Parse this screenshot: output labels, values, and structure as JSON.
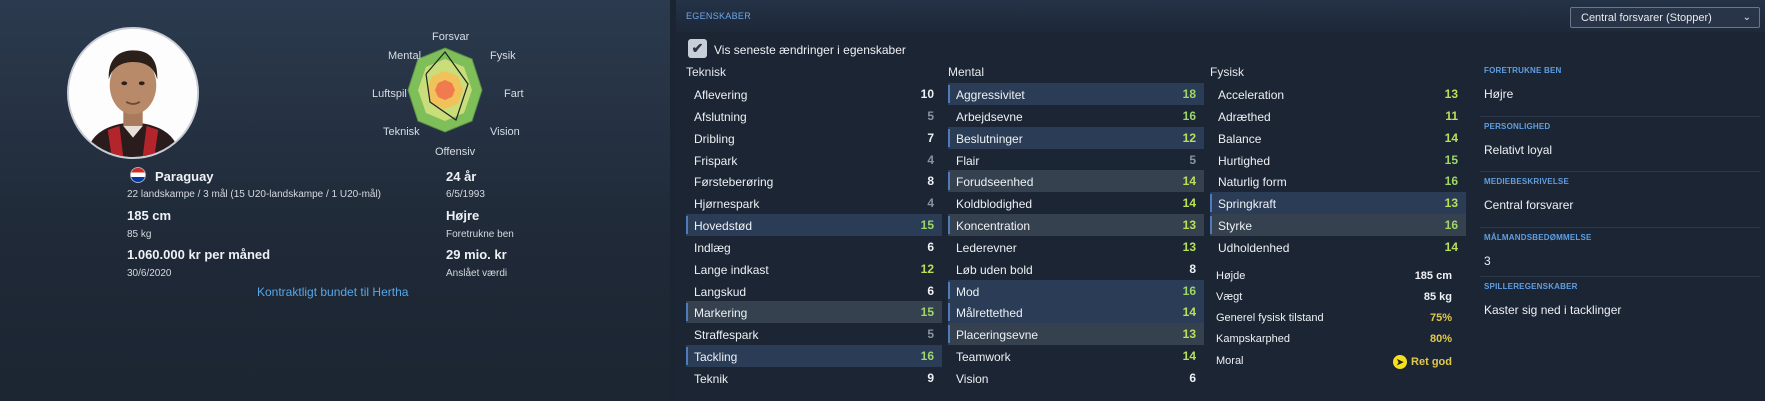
{
  "player": {
    "nation": "Paraguay",
    "caps_text": "22 landskampe / 3 mål (15 U20-landskampe / 1 U20-mål)",
    "height": "185 cm",
    "weight": "85 kg",
    "wage": "1.060.000 kr per måned",
    "contract_end": "30/6/2020",
    "age": "24 år",
    "birth_date": "6/5/1993",
    "preferred_foot": "Højre",
    "preferred_foot_label": "Foretrukne ben",
    "value": "29 mio. kr",
    "value_label": "Anslået værdi",
    "contract_link": "Kontraktligt bundet til Hertha"
  },
  "radar": {
    "labels": {
      "top": "Forsvar",
      "top_right": "Fysik",
      "right": "Fart",
      "bottom_right": "Vision",
      "bottom": "Offensiv",
      "bottom_left": "Teknisk",
      "left": "Luftspil",
      "top_left": "Mental"
    },
    "colors": {
      "outer": "#7fbf5a",
      "mid": "#c9de7a",
      "inner": "#f2c25a",
      "core": "#ef7b4e"
    }
  },
  "attributes_panel": {
    "title": "EGENSKABER",
    "role_select": "Central forsvarer (Stopper)",
    "checkbox_label": "Vis seneste ændringer i egenskaber",
    "checkbox_checked": true,
    "columns": [
      {
        "title": "Teknisk",
        "rows": [
          {
            "name": "Aflevering",
            "value": "10",
            "color": "white",
            "highlight": ""
          },
          {
            "name": "Afslutning",
            "value": "5",
            "color": "dim",
            "highlight": ""
          },
          {
            "name": "Dribling",
            "value": "7",
            "color": "white",
            "highlight": ""
          },
          {
            "name": "Frispark",
            "value": "4",
            "color": "dim",
            "highlight": ""
          },
          {
            "name": "Førsteberøring",
            "value": "8",
            "color": "white",
            "highlight": ""
          },
          {
            "name": "Hjørnespark",
            "value": "4",
            "color": "dim",
            "highlight": ""
          },
          {
            "name": "Hovedstød",
            "value": "15",
            "color": "green",
            "highlight": "hl"
          },
          {
            "name": "Indlæg",
            "value": "6",
            "color": "white",
            "highlight": ""
          },
          {
            "name": "Lange indkast",
            "value": "12",
            "color": "lime",
            "highlight": ""
          },
          {
            "name": "Langskud",
            "value": "6",
            "color": "white",
            "highlight": ""
          },
          {
            "name": "Markering",
            "value": "15",
            "color": "green",
            "highlight": "hl2"
          },
          {
            "name": "Straffespark",
            "value": "5",
            "color": "dim",
            "highlight": ""
          },
          {
            "name": "Tackling",
            "value": "16",
            "color": "green",
            "highlight": "hl"
          },
          {
            "name": "Teknik",
            "value": "9",
            "color": "white",
            "highlight": ""
          }
        ]
      },
      {
        "title": "Mental",
        "rows": [
          {
            "name": "Aggressivitet",
            "value": "18",
            "color": "green",
            "highlight": "hl"
          },
          {
            "name": "Arbejdsevne",
            "value": "16",
            "color": "green",
            "highlight": ""
          },
          {
            "name": "Beslutninger",
            "value": "12",
            "color": "lime",
            "highlight": "hl"
          },
          {
            "name": "Flair",
            "value": "5",
            "color": "dim",
            "highlight": ""
          },
          {
            "name": "Forudseenhed",
            "value": "14",
            "color": "lime",
            "highlight": "hl2"
          },
          {
            "name": "Koldblodighed",
            "value": "14",
            "color": "lime",
            "highlight": ""
          },
          {
            "name": "Koncentration",
            "value": "13",
            "color": "lime",
            "highlight": "hl2"
          },
          {
            "name": "Lederevner",
            "value": "13",
            "color": "lime",
            "highlight": ""
          },
          {
            "name": "Løb uden bold",
            "value": "8",
            "color": "white",
            "highlight": ""
          },
          {
            "name": "Mod",
            "value": "16",
            "color": "green",
            "highlight": "hl"
          },
          {
            "name": "Målrettethed",
            "value": "14",
            "color": "lime",
            "highlight": "hl"
          },
          {
            "name": "Placeringsevne",
            "value": "13",
            "color": "lime",
            "highlight": "hl2"
          },
          {
            "name": "Teamwork",
            "value": "14",
            "color": "lime",
            "highlight": ""
          },
          {
            "name": "Vision",
            "value": "6",
            "color": "white",
            "highlight": ""
          }
        ]
      },
      {
        "title": "Fysisk",
        "rows": [
          {
            "name": "Acceleration",
            "value": "13",
            "color": "lime",
            "highlight": ""
          },
          {
            "name": "Adræthed",
            "value": "11",
            "color": "lime",
            "highlight": ""
          },
          {
            "name": "Balance",
            "value": "14",
            "color": "lime",
            "highlight": ""
          },
          {
            "name": "Hurtighed",
            "value": "15",
            "color": "green",
            "highlight": ""
          },
          {
            "name": "Naturlig form",
            "value": "16",
            "color": "green",
            "highlight": ""
          },
          {
            "name": "Springkraft",
            "value": "13",
            "color": "lime",
            "highlight": "hl"
          },
          {
            "name": "Styrke",
            "value": "16",
            "color": "green",
            "highlight": "hl2"
          },
          {
            "name": "Udholdenhed",
            "value": "14",
            "color": "lime",
            "highlight": ""
          }
        ]
      }
    ],
    "physical_info": [
      {
        "label": "Højde",
        "value": "185 cm",
        "color": "white"
      },
      {
        "label": "Vægt",
        "value": "85 kg",
        "color": "white"
      },
      {
        "label": "Generel fysisk tilstand",
        "value": "75%",
        "color": "yellow"
      },
      {
        "label": "Kampskarphed",
        "value": "80%",
        "color": "yellow"
      },
      {
        "label": "Moral",
        "value": "Ret god",
        "color": "yellow",
        "icon": "moral-arrow-icon"
      }
    ],
    "side": [
      {
        "heading": "FORETRUKNE BEN",
        "value": "Højre"
      },
      {
        "heading": "PERSONLIGHED",
        "value": "Relativt loyal"
      },
      {
        "heading": "MEDIEBESKRIVELSE",
        "value": "Central forsvarer"
      },
      {
        "heading": "MÅLMANDSBEDØMMELSE",
        "value": "3"
      },
      {
        "heading": "SPILLEREGENSKABER",
        "value": "Kaster sig ned i tacklinger"
      }
    ]
  }
}
